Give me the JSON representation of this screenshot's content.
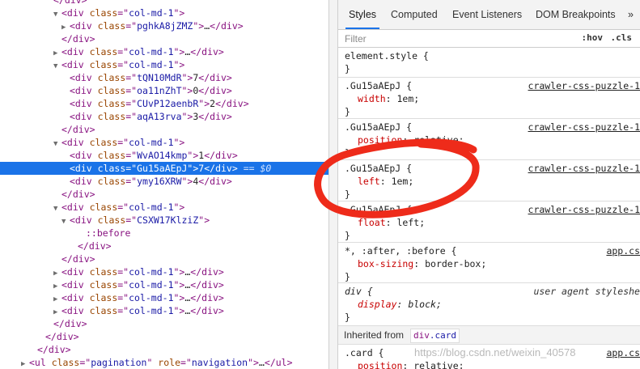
{
  "dom_tree": {
    "rows": [
      {
        "indent": 6,
        "tri": "",
        "parts": [
          [
            "tag",
            "</div>"
          ]
        ]
      },
      {
        "indent": 7,
        "tri": "▼",
        "parts": [
          [
            "tag",
            "<div "
          ],
          [
            "attr",
            "class"
          ],
          [
            "tag",
            "=\""
          ],
          [
            "val",
            "col-md-1"
          ],
          [
            "tag",
            "\">"
          ]
        ]
      },
      {
        "indent": 8,
        "tri": "▶",
        "parts": [
          [
            "tag",
            "<div "
          ],
          [
            "attr",
            "class"
          ],
          [
            "tag",
            "=\""
          ],
          [
            "val",
            "pghkA8jZMZ"
          ],
          [
            "tag",
            "\">"
          ],
          [
            "txt",
            "…"
          ],
          [
            "tag",
            "</div>"
          ]
        ]
      },
      {
        "indent": 7,
        "tri": "",
        "parts": [
          [
            "tag",
            "</div>"
          ]
        ]
      },
      {
        "indent": 7,
        "tri": "▶",
        "parts": [
          [
            "tag",
            "<div "
          ],
          [
            "attr",
            "class"
          ],
          [
            "tag",
            "=\""
          ],
          [
            "val",
            "col-md-1"
          ],
          [
            "tag",
            "\">"
          ],
          [
            "txt",
            "…"
          ],
          [
            "tag",
            "</div>"
          ]
        ]
      },
      {
        "indent": 7,
        "tri": "▼",
        "parts": [
          [
            "tag",
            "<div "
          ],
          [
            "attr",
            "class"
          ],
          [
            "tag",
            "=\""
          ],
          [
            "val",
            "col-md-1"
          ],
          [
            "tag",
            "\">"
          ]
        ]
      },
      {
        "indent": 8,
        "tri": "",
        "parts": [
          [
            "tag",
            "<div "
          ],
          [
            "attr",
            "class"
          ],
          [
            "tag",
            "=\""
          ],
          [
            "val",
            "tQN10MdR"
          ],
          [
            "tag",
            "\">"
          ],
          [
            "txt",
            "7"
          ],
          [
            "tag",
            "</div>"
          ]
        ]
      },
      {
        "indent": 8,
        "tri": "",
        "parts": [
          [
            "tag",
            "<div "
          ],
          [
            "attr",
            "class"
          ],
          [
            "tag",
            "=\""
          ],
          [
            "val",
            "oa11nZhT"
          ],
          [
            "tag",
            "\">"
          ],
          [
            "txt",
            "0"
          ],
          [
            "tag",
            "</div>"
          ]
        ]
      },
      {
        "indent": 8,
        "tri": "",
        "parts": [
          [
            "tag",
            "<div "
          ],
          [
            "attr",
            "class"
          ],
          [
            "tag",
            "=\""
          ],
          [
            "val",
            "CUvP12aenbR"
          ],
          [
            "tag",
            "\">"
          ],
          [
            "txt",
            "2"
          ],
          [
            "tag",
            "</div>"
          ]
        ]
      },
      {
        "indent": 8,
        "tri": "",
        "parts": [
          [
            "tag",
            "<div "
          ],
          [
            "attr",
            "class"
          ],
          [
            "tag",
            "=\""
          ],
          [
            "val",
            "aqA13rva"
          ],
          [
            "tag",
            "\">"
          ],
          [
            "txt",
            "3"
          ],
          [
            "tag",
            "</div>"
          ]
        ]
      },
      {
        "indent": 7,
        "tri": "",
        "parts": [
          [
            "tag",
            "</div>"
          ]
        ]
      },
      {
        "indent": 7,
        "tri": "▼",
        "parts": [
          [
            "tag",
            "<div "
          ],
          [
            "attr",
            "class"
          ],
          [
            "tag",
            "=\""
          ],
          [
            "val",
            "col-md-1"
          ],
          [
            "tag",
            "\">"
          ]
        ]
      },
      {
        "indent": 8,
        "tri": "",
        "parts": [
          [
            "tag",
            "<div "
          ],
          [
            "attr",
            "class"
          ],
          [
            "tag",
            "=\""
          ],
          [
            "val",
            "WvAO14kmp"
          ],
          [
            "tag",
            "\">"
          ],
          [
            "txt",
            "1"
          ],
          [
            "tag",
            "</div>"
          ]
        ]
      },
      {
        "indent": 8,
        "tri": "",
        "selected": true,
        "parts": [
          [
            "tag",
            "<div "
          ],
          [
            "attr",
            "class"
          ],
          [
            "tag",
            "=\""
          ],
          [
            "val",
            "Gu15aAEpJ"
          ],
          [
            "tag",
            "\">"
          ],
          [
            "txt",
            "7"
          ],
          [
            "tag",
            "</div>"
          ]
        ],
        "suffix": " == $0"
      },
      {
        "indent": 8,
        "tri": "",
        "parts": [
          [
            "tag",
            "<div "
          ],
          [
            "attr",
            "class"
          ],
          [
            "tag",
            "=\""
          ],
          [
            "val",
            "ymy16XRW"
          ],
          [
            "tag",
            "\">"
          ],
          [
            "txt",
            "4"
          ],
          [
            "tag",
            "</div>"
          ]
        ]
      },
      {
        "indent": 7,
        "tri": "",
        "parts": [
          [
            "tag",
            "</div>"
          ]
        ]
      },
      {
        "indent": 7,
        "tri": "▼",
        "parts": [
          [
            "tag",
            "<div "
          ],
          [
            "attr",
            "class"
          ],
          [
            "tag",
            "=\""
          ],
          [
            "val",
            "col-md-1"
          ],
          [
            "tag",
            "\">"
          ]
        ]
      },
      {
        "indent": 8,
        "tri": "▼",
        "parts": [
          [
            "tag",
            "<div "
          ],
          [
            "attr",
            "class"
          ],
          [
            "tag",
            "=\""
          ],
          [
            "val",
            "CSXW17KlziZ"
          ],
          [
            "tag",
            "\">"
          ]
        ]
      },
      {
        "indent": 10,
        "tri": "",
        "parts": [
          [
            "pseudo",
            "::before"
          ]
        ]
      },
      {
        "indent": 9,
        "tri": "",
        "parts": [
          [
            "tag",
            "</div>"
          ]
        ]
      },
      {
        "indent": 7,
        "tri": "",
        "parts": [
          [
            "tag",
            "</div>"
          ]
        ]
      },
      {
        "indent": 7,
        "tri": "▶",
        "parts": [
          [
            "tag",
            "<div "
          ],
          [
            "attr",
            "class"
          ],
          [
            "tag",
            "=\""
          ],
          [
            "val",
            "col-md-1"
          ],
          [
            "tag",
            "\">"
          ],
          [
            "txt",
            "…"
          ],
          [
            "tag",
            "</div>"
          ]
        ]
      },
      {
        "indent": 7,
        "tri": "▶",
        "parts": [
          [
            "tag",
            "<div "
          ],
          [
            "attr",
            "class"
          ],
          [
            "tag",
            "=\""
          ],
          [
            "val",
            "col-md-1"
          ],
          [
            "tag",
            "\">"
          ],
          [
            "txt",
            "…"
          ],
          [
            "tag",
            "</div>"
          ]
        ]
      },
      {
        "indent": 7,
        "tri": "▶",
        "parts": [
          [
            "tag",
            "<div "
          ],
          [
            "attr",
            "class"
          ],
          [
            "tag",
            "=\""
          ],
          [
            "val",
            "col-md-1"
          ],
          [
            "tag",
            "\">"
          ],
          [
            "txt",
            "…"
          ],
          [
            "tag",
            "</div>"
          ]
        ]
      },
      {
        "indent": 7,
        "tri": "▶",
        "parts": [
          [
            "tag",
            "<div "
          ],
          [
            "attr",
            "class"
          ],
          [
            "tag",
            "=\""
          ],
          [
            "val",
            "col-md-1"
          ],
          [
            "tag",
            "\">"
          ],
          [
            "txt",
            "…"
          ],
          [
            "tag",
            "</div>"
          ]
        ]
      },
      {
        "indent": 6,
        "tri": "",
        "parts": [
          [
            "tag",
            "</div>"
          ]
        ]
      },
      {
        "indent": 5,
        "tri": "",
        "parts": [
          [
            "tag",
            "</div>"
          ]
        ]
      },
      {
        "indent": 4,
        "tri": "",
        "parts": [
          [
            "tag",
            "</div>"
          ]
        ]
      },
      {
        "indent": 3,
        "tri": "▶",
        "parts": [
          [
            "tag",
            "<ul "
          ],
          [
            "attr",
            "class"
          ],
          [
            "tag",
            "=\""
          ],
          [
            "val",
            "pagination"
          ],
          [
            "tag",
            "\" "
          ],
          [
            "attr",
            "role"
          ],
          [
            "tag",
            "=\""
          ],
          [
            "val",
            "navigation"
          ],
          [
            "tag",
            "\">"
          ],
          [
            "txt",
            "…"
          ],
          [
            "tag",
            "</ul>"
          ]
        ]
      }
    ]
  },
  "tabs": [
    "Styles",
    "Computed",
    "Event Listeners",
    "DOM Breakpoints",
    "»"
  ],
  "filter": {
    "placeholder": "Filter",
    "hov": ":hov",
    "cls": ".cls"
  },
  "rules": [
    {
      "selector": "element.style {",
      "source": "",
      "decls": [],
      "close": "}"
    },
    {
      "selector": ".Gu15aAEpJ {",
      "source": "crawler-css-puzzle-1",
      "decls": [
        [
          "width",
          "1em"
        ]
      ],
      "close": "}"
    },
    {
      "selector": ".Gu15aAEpJ {",
      "source": "crawler-css-puzzle-1",
      "decls": [
        [
          "position",
          "relative"
        ]
      ],
      "close": "}"
    },
    {
      "selector": ".Gu15aAEpJ {",
      "source": "crawler-css-puzzle-1",
      "decls": [
        [
          "left",
          "1em"
        ]
      ],
      "close": "}"
    },
    {
      "selector": ".Gu15aAEpJ {",
      "source": "crawler-css-puzzle-1",
      "decls": [
        [
          "float",
          "left"
        ]
      ],
      "close": "}"
    },
    {
      "selector": "*, :after, :before {",
      "source": "app.cs",
      "decls": [
        [
          "box-sizing",
          "border-box"
        ]
      ],
      "close": "}"
    },
    {
      "selector": "div {",
      "source": "user agent styleshe",
      "decls": [
        [
          "display",
          "block"
        ]
      ],
      "close": "}",
      "ua": true
    }
  ],
  "inherited": {
    "label": "Inherited from",
    "tag": "div",
    "cls": ".card"
  },
  "card_rule": {
    "selector": ".card {",
    "source": "app.cs",
    "decls": [
      [
        "position",
        "relative"
      ]
    ]
  },
  "watermark": "https://blog.csdn.net/weixin_40578"
}
